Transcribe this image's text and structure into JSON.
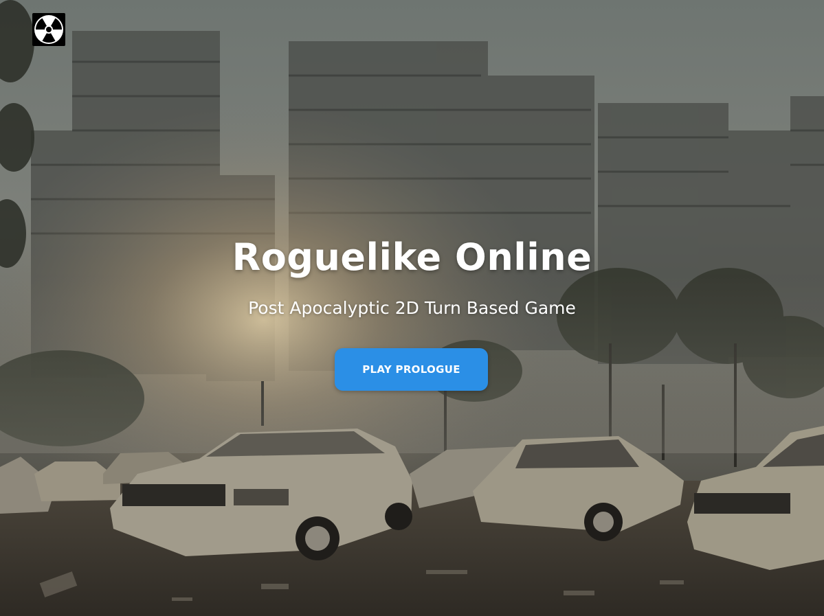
{
  "header": {
    "logo_icon": "radiation-icon"
  },
  "hero": {
    "title": "Roguelike Online",
    "subtitle": "Post Apocalyptic 2D Turn Based Game",
    "play_button_label": "PLAY PROLOGUE"
  },
  "colors": {
    "button": "#2b8fe6",
    "text": "#ffffff",
    "logo_bg": "#000000"
  }
}
